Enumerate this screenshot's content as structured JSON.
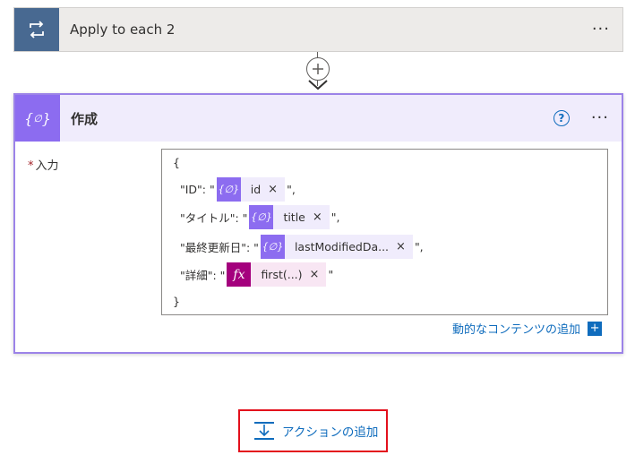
{
  "loop": {
    "title": "Apply to each 2",
    "menu": "···",
    "icon": "loop-icon"
  },
  "compose": {
    "title": "作成",
    "help": "?",
    "menu": "···",
    "icon": "braces-icon",
    "input_label": "入力",
    "required_mark": "*",
    "editor": {
      "open_brace": "{",
      "close_brace": "}",
      "lines": [
        {
          "prefix": "\"ID\": \"",
          "token": "id",
          "token_type": "dynamic",
          "suffix": "\","
        },
        {
          "prefix": "\"タイトル\": \"",
          "token": "title",
          "token_type": "dynamic",
          "suffix": "\","
        },
        {
          "prefix": "\"最終更新日\": \"",
          "token": "lastModifiedDa...",
          "token_type": "dynamic",
          "suffix": "\","
        },
        {
          "prefix": "\"詳細\": \"",
          "token": "first(...)",
          "token_type": "expression",
          "suffix": "\""
        }
      ],
      "token_icon_dynamic": "{ }",
      "token_icon_expression": "fx",
      "remove": "×"
    },
    "add_dynamic_label": "動的なコンテンツの追加",
    "add_dynamic_plus": "+"
  },
  "add_action": {
    "label": "アクションの追加",
    "icon": "insert-step-icon"
  },
  "colors": {
    "loop": "#486991",
    "compose": "#8c6cf0",
    "expression": "#a4007d",
    "link": "#0f6cbd",
    "highlight": "#e3101c"
  }
}
